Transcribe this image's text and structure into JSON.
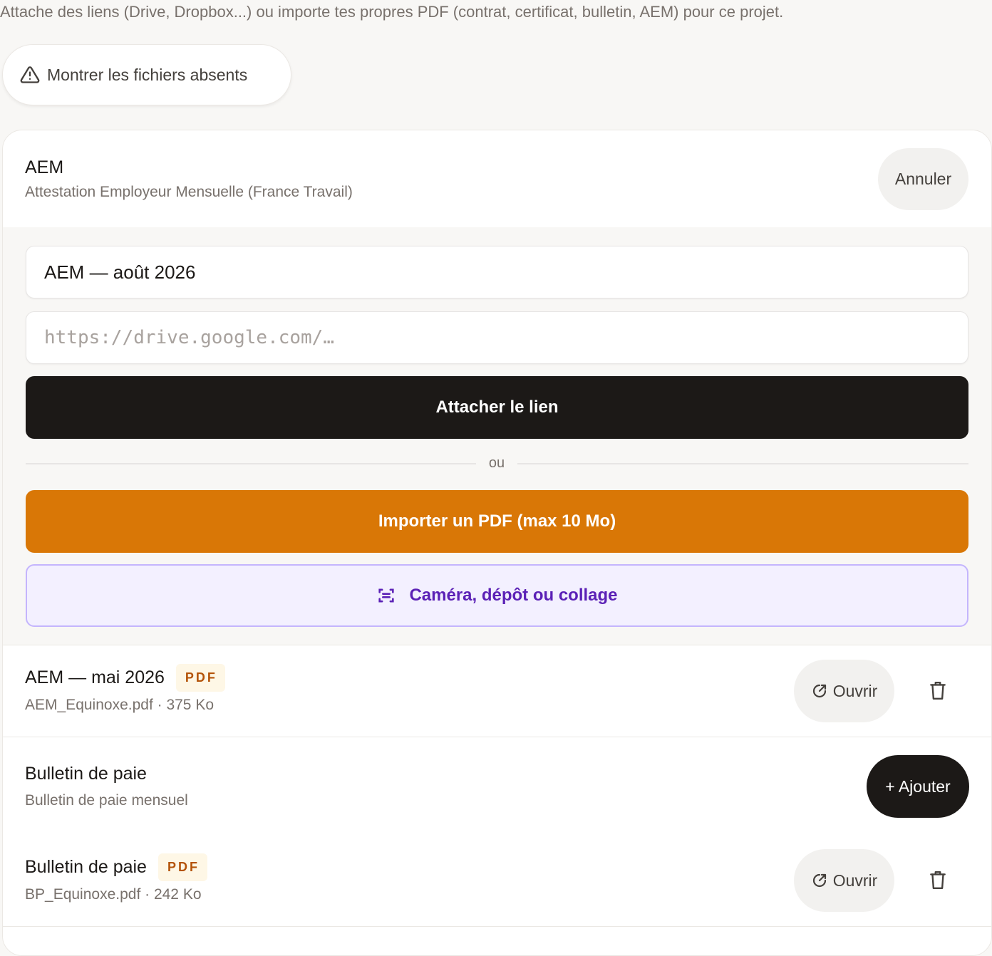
{
  "intro_text": "Attache des liens (Drive, Dropbox...) ou importe tes propres PDF (contrat, certificat, bulletin, AEM) pour ce projet.",
  "missing_files_button": {
    "label": "Montrer les fichiers absents",
    "icon": "warning-triangle-icon"
  },
  "active_type": {
    "title": "AEM",
    "subtitle": "Attestation Employeur Mensuelle (France Travail)",
    "cancel_label": "Annuler"
  },
  "form": {
    "title_value": "AEM — août 2026",
    "url_placeholder": "https://drive.google.com/…",
    "attach_label": "Attacher le lien",
    "divider_text": "ou",
    "import_label": "Importer un PDF (max 10 Mo)",
    "camera_label": "Caméra, dépôt ou collage",
    "camera_icon": "scan-icon"
  },
  "files": [
    {
      "title": "AEM — mai 2026",
      "badge": "PDF",
      "meta": "AEM_Equinoxe.pdf · 375 Ko",
      "open_label": "Ouvrir"
    },
    {
      "title": "Bulletin de paie",
      "badge": "PDF",
      "meta": "BP_Equinoxe.pdf · 242 Ko",
      "open_label": "Ouvrir"
    }
  ],
  "doc_type": {
    "title": "Bulletin de paie",
    "subtitle": "Bulletin de paie mensuel",
    "add_label": "+ Ajouter"
  },
  "colors": {
    "accent_orange": "#d97706",
    "accent_violet": "#5b21b6",
    "dark": "#1c1917",
    "badge_text": "#b45309"
  }
}
